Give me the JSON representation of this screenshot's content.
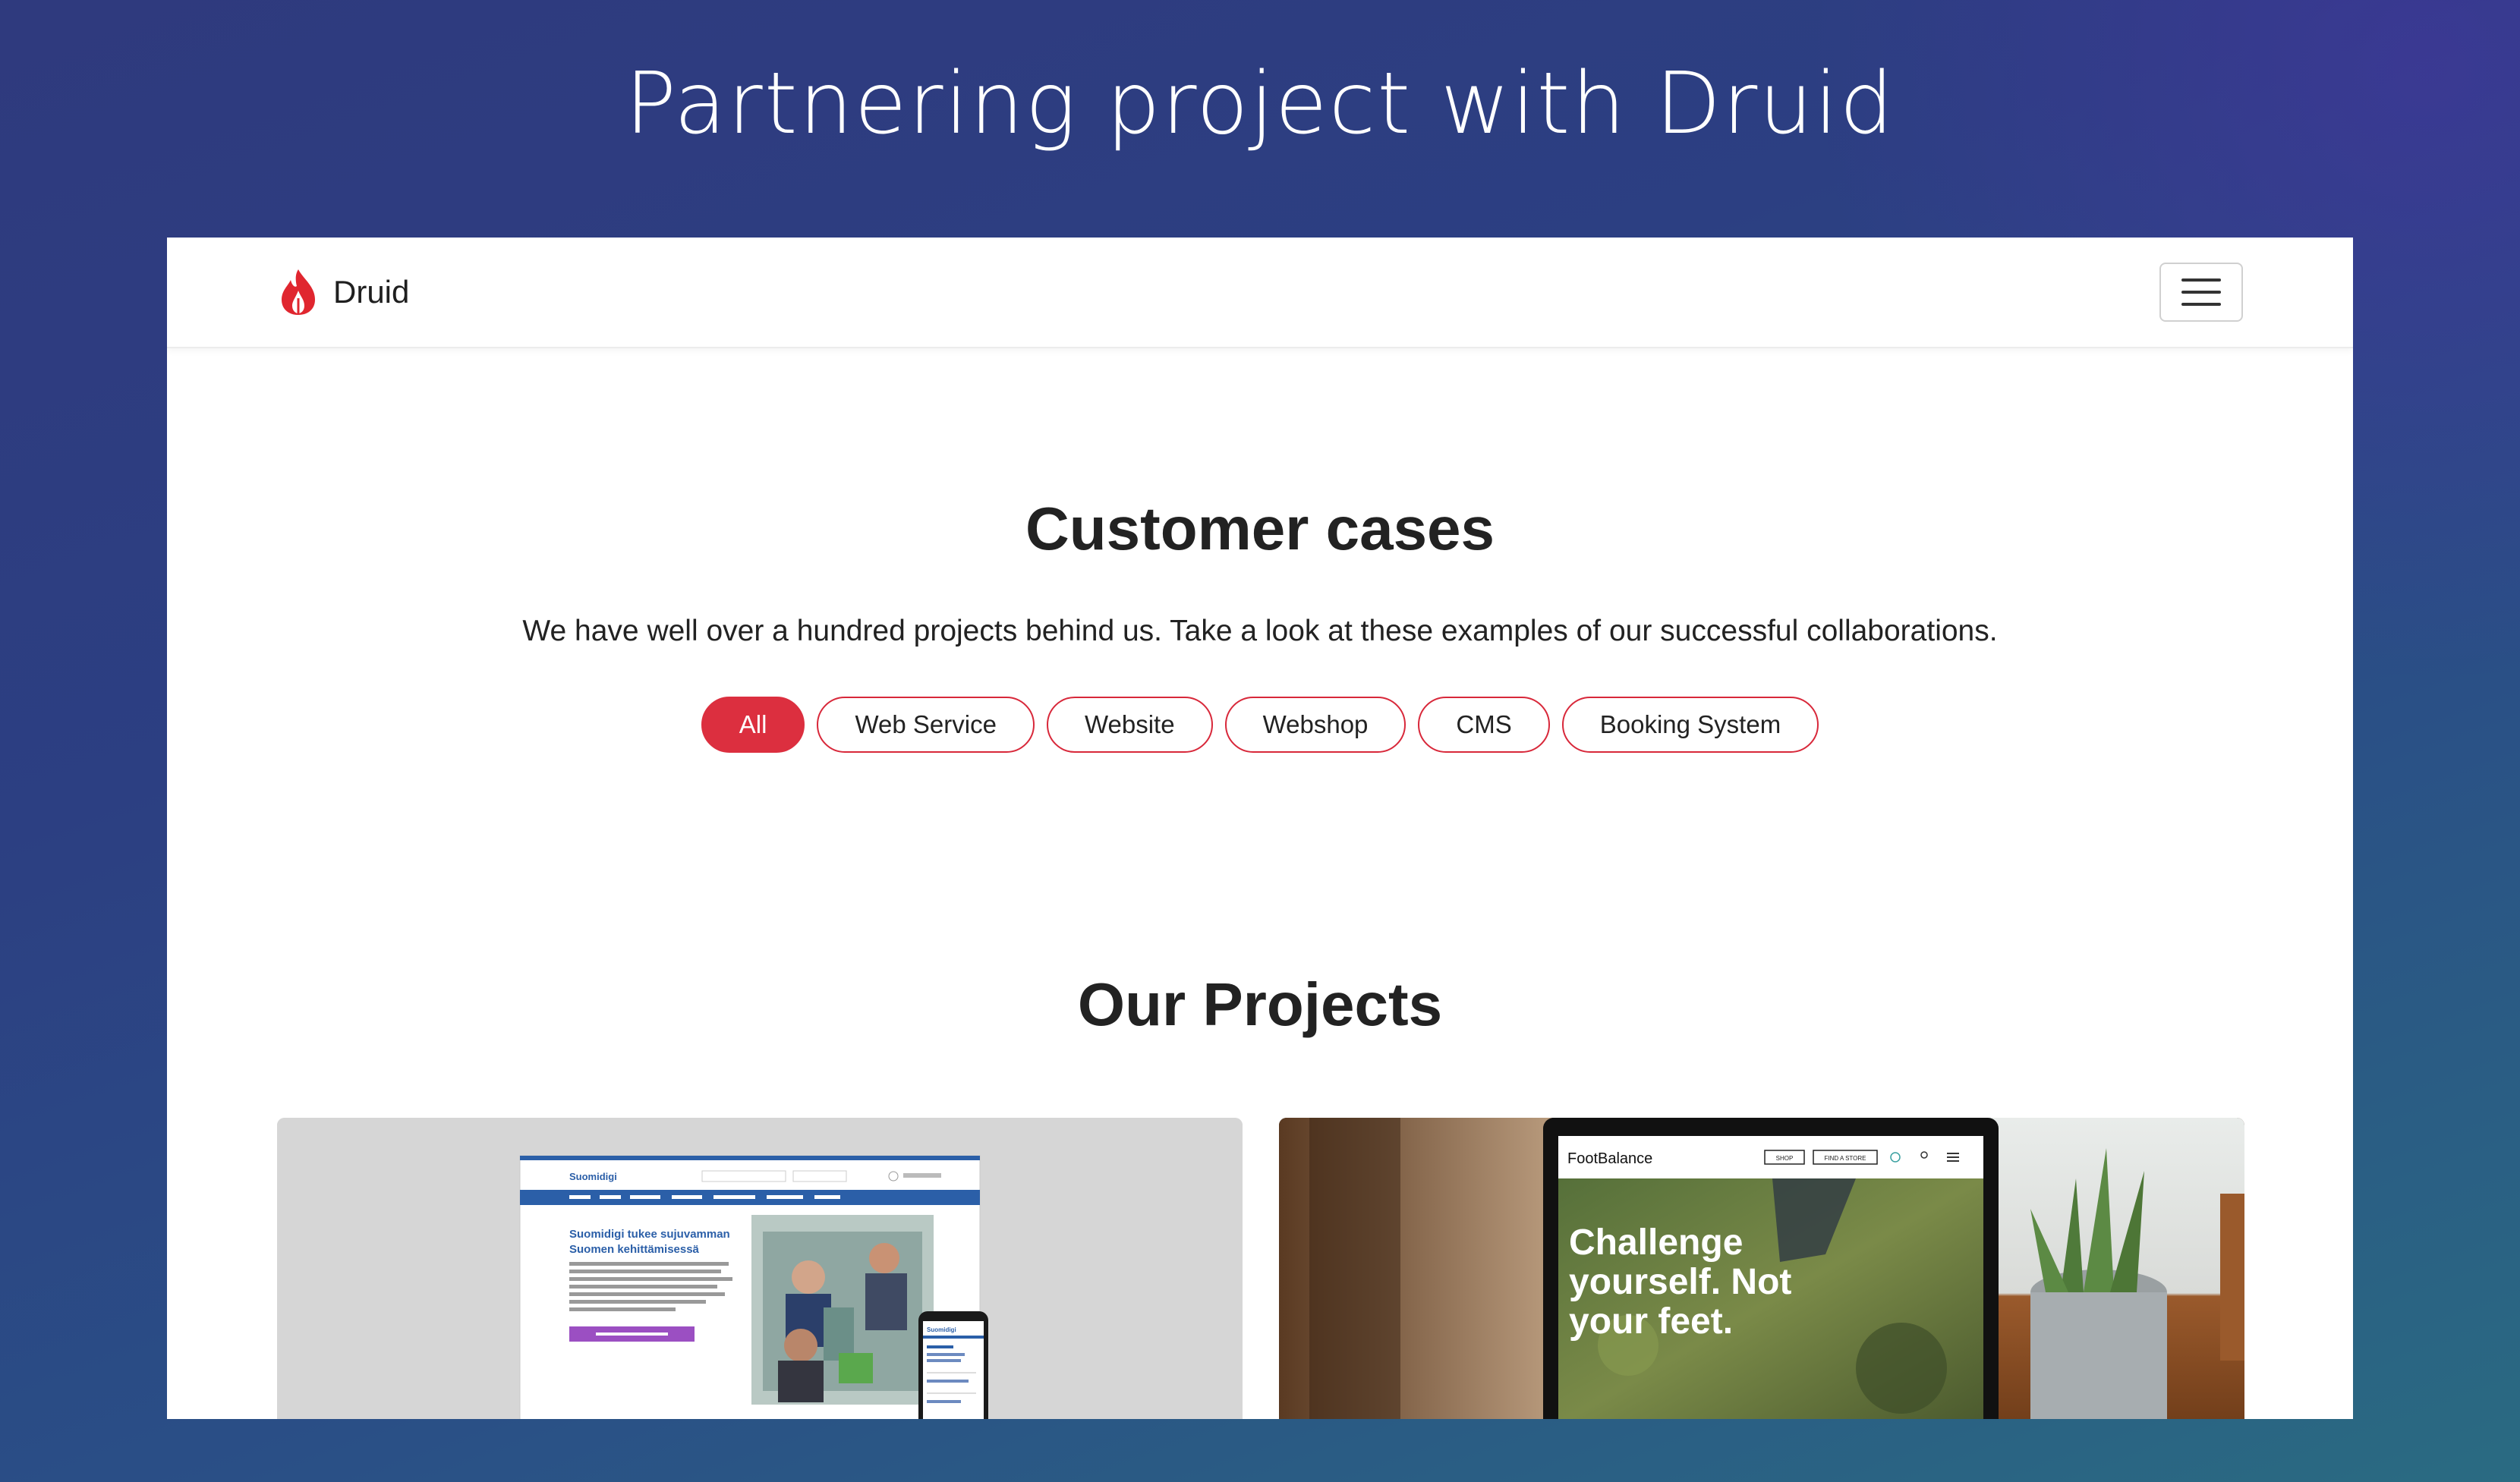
{
  "headline": "Partnering project with Druid",
  "navbar": {
    "brand": "Druid",
    "menu_icon": "hamburger-icon"
  },
  "customer_cases": {
    "title": "Customer cases",
    "subtitle": "We have well over a hundred projects behind us. Take a look at these examples of our successful collaborations.",
    "filters": [
      {
        "label": "All",
        "active": true
      },
      {
        "label": "Web Service",
        "active": false
      },
      {
        "label": "Website",
        "active": false
      },
      {
        "label": "Webshop",
        "active": false
      },
      {
        "label": "CMS",
        "active": false
      },
      {
        "label": "Booking System",
        "active": false
      }
    ]
  },
  "projects": {
    "title": "Our Projects",
    "cards": [
      {
        "site_logo": "Suomidigi",
        "site_heading": "Suomidigi tukee sujuvamman Suomen kehittämisessä",
        "mobile_logo": "Suomidigi"
      },
      {
        "site_logo": "FootBalance",
        "shop_btn": "SHOP",
        "store_btn": "FIND A STORE",
        "hero_text": "Challenge yourself. Not your feet."
      }
    ]
  },
  "colors": {
    "accent": "#dc2f3f",
    "suomidigi_blue": "#2b5fa8",
    "suomidigi_purple": "#9b4fc2"
  }
}
